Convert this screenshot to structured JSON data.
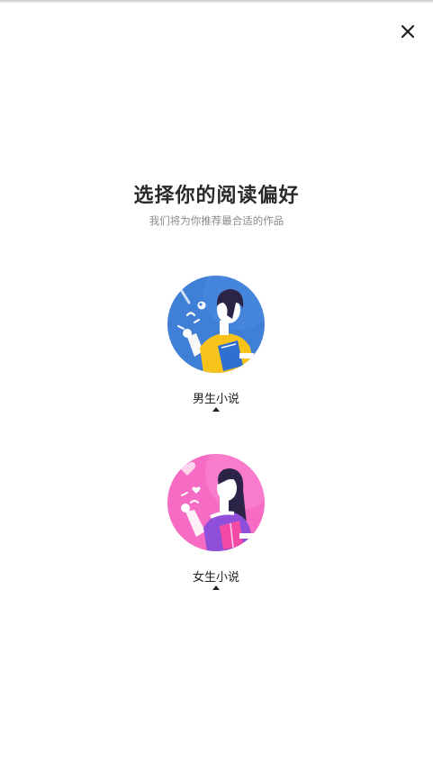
{
  "header": {
    "close_icon": "close-icon"
  },
  "intro": {
    "title": "选择你的阅读偏好",
    "subtitle": "我们将为你推荐最合适的作品"
  },
  "options": [
    {
      "label": "男生小说",
      "icon": "male-reader-illustration",
      "accent": "#3a7bd5"
    },
    {
      "label": "女生小说",
      "icon": "female-reader-illustration",
      "accent": "#f06ac0"
    }
  ],
  "colors": {
    "title": "#2a2a2a",
    "subtitle": "#8a8a8a",
    "background": "#ffffff"
  }
}
